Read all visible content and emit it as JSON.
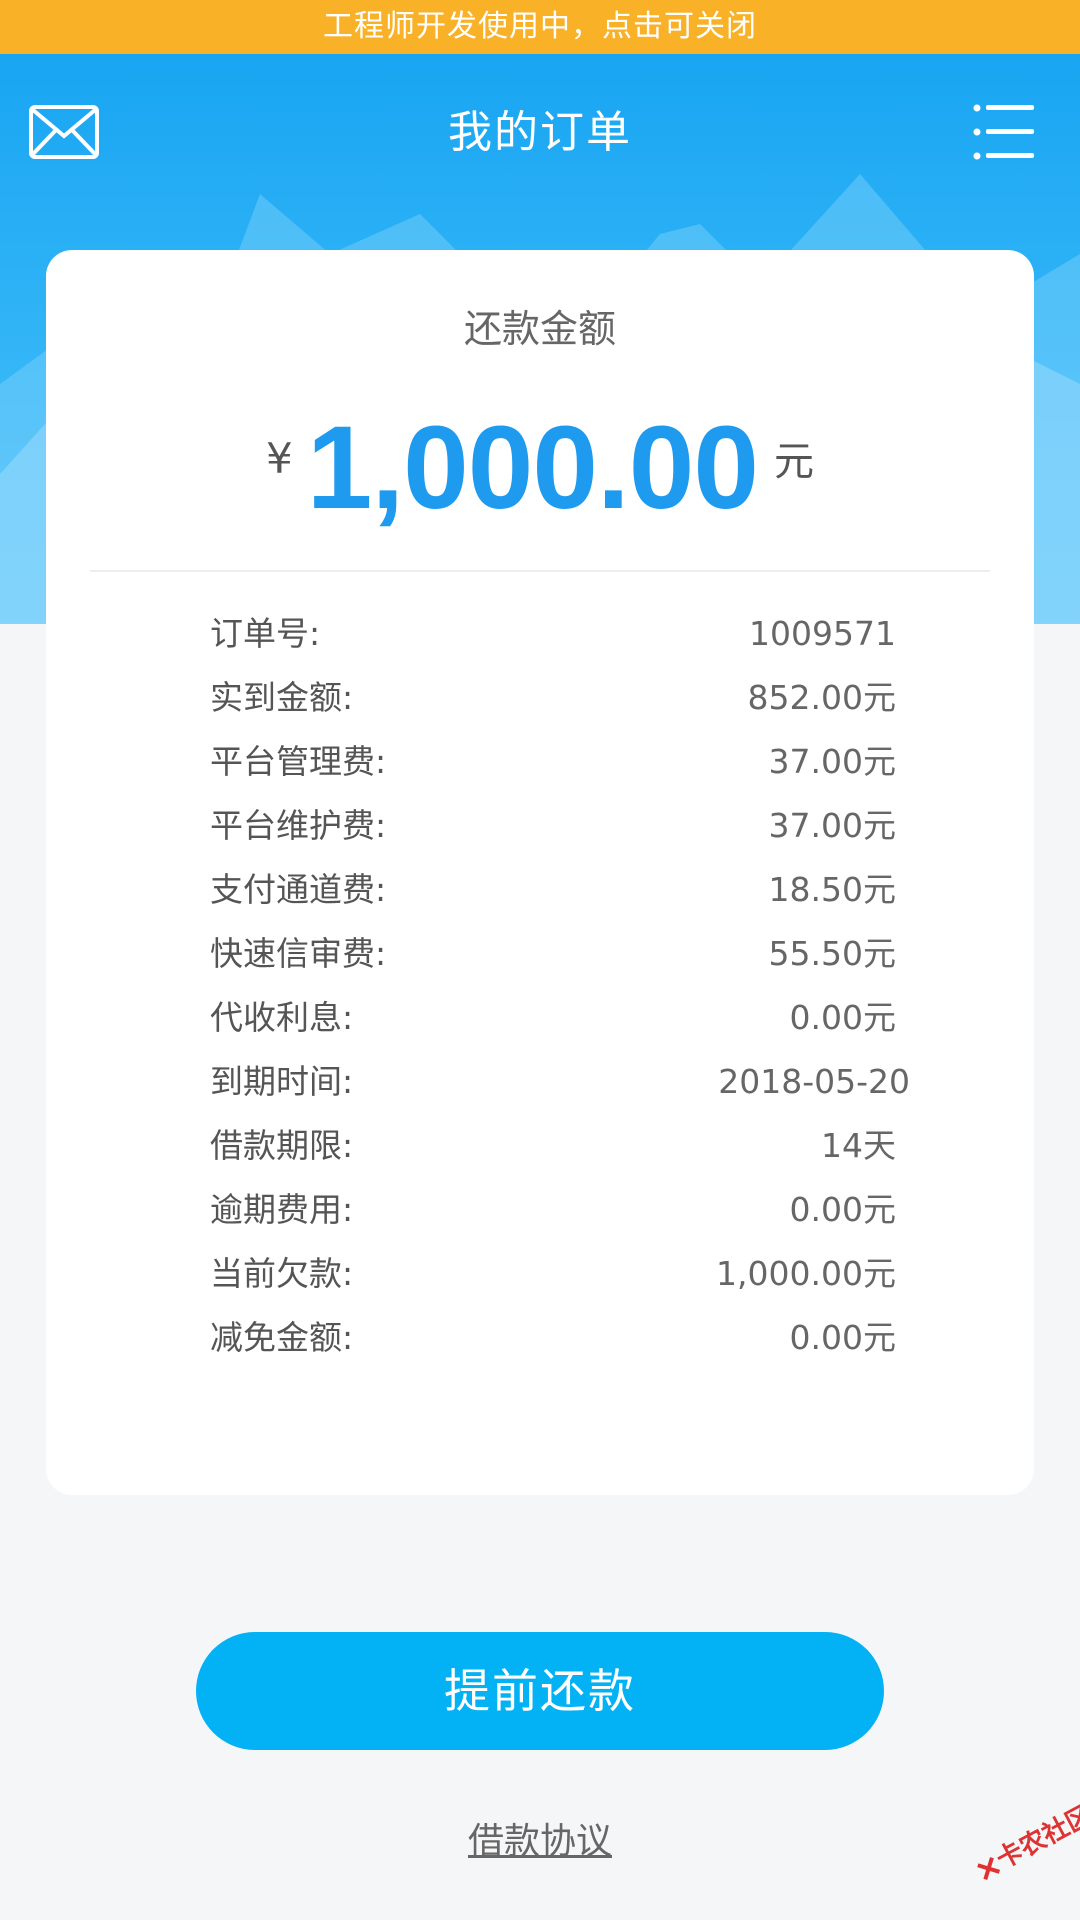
{
  "dev_banner": {
    "text": "工程师开发使用中，点击可关闭"
  },
  "header": {
    "title": "我的订单",
    "left_icon": "mail-icon",
    "right_icon": "menu-list-icon"
  },
  "card": {
    "amount_label": "还款金额",
    "currency_symbol": "¥",
    "amount": "1,000.00",
    "amount_unit": "元",
    "details": [
      {
        "label": "订单号:",
        "value": "1009571"
      },
      {
        "label": "实到金额:",
        "value": "852.00元"
      },
      {
        "label": "平台管理费:",
        "value": "37.00元"
      },
      {
        "label": "平台维护费:",
        "value": "37.00元"
      },
      {
        "label": "支付通道费:",
        "value": "18.50元"
      },
      {
        "label": "快速信审费:",
        "value": "55.50元"
      },
      {
        "label": "代收利息:",
        "value": "0.00元"
      },
      {
        "label": "到期时间:",
        "value": "2018-05-20"
      },
      {
        "label": "借款期限:",
        "value": "14天"
      },
      {
        "label": "逾期费用:",
        "value": "0.00元"
      },
      {
        "label": "当前欠款:",
        "value": "1,000.00元"
      },
      {
        "label": "减免金额:",
        "value": "0.00元"
      }
    ]
  },
  "actions": {
    "repay_label": "提前还款",
    "agreement_label": "借款协议"
  },
  "watermark": {
    "text": "卡农社区"
  },
  "colors": {
    "banner": "#f9b228",
    "header_blue": "#19a5f2",
    "amount_blue": "#1e9bef",
    "button_blue": "#03b1f5"
  }
}
